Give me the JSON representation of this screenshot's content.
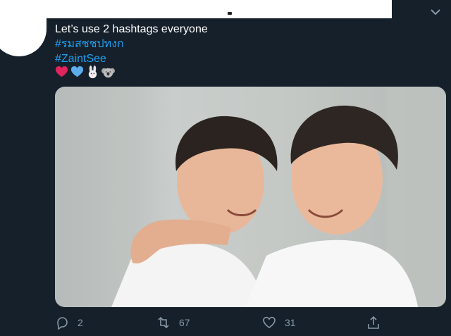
{
  "tweet": {
    "text_line": "Let’s use 2 hashtags everyone",
    "hashtag_1": "#รมสชชปทงก",
    "hashtag_2": "#ZaintSee",
    "emojis": [
      "red-heart-icon",
      "blue-heart-icon",
      "rabbit-icon",
      "koala-icon"
    ]
  },
  "actions": {
    "reply_count": "2",
    "retweet_count": "67",
    "like_count": "31"
  },
  "colors": {
    "background": "#15202b",
    "link": "#1da1f2",
    "muted": "#8899a6"
  }
}
